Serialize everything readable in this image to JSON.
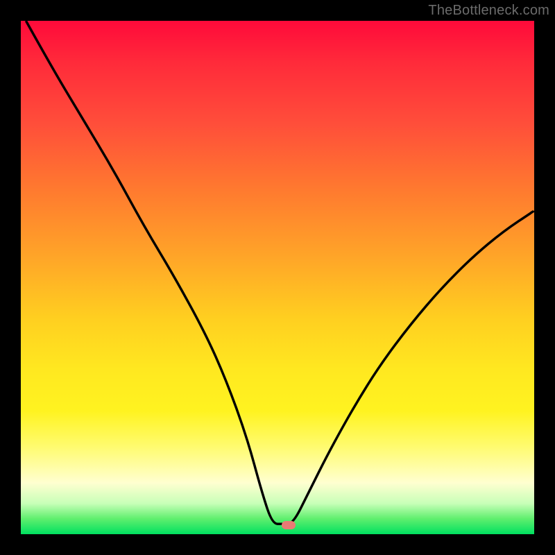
{
  "watermark": "TheBottleneck.com",
  "colors": {
    "gradient_top": "#ff0a3a",
    "gradient_mid1": "#ff7a2f",
    "gradient_mid2": "#ffe820",
    "gradient_bottom": "#00e060",
    "curve": "#000000",
    "marker": "#e97b74",
    "frame": "#000000"
  },
  "marker": {
    "x_frac": 0.522,
    "y_frac": 0.982
  },
  "chart_data": {
    "type": "line",
    "title": "",
    "xlabel": "",
    "ylabel": "",
    "xlim": [
      0,
      100
    ],
    "ylim": [
      0,
      100
    ],
    "grid": false,
    "legend": false,
    "note": "Axes are unlabeled in the source image; values are positional fractions (0–100) read from pixel positions. The curve is a V-shaped bottleneck profile: two descending arms meeting a short flat minimum near y≈2 around x≈48–53, with the right arm rising more gently than the left.",
    "series": [
      {
        "name": "bottleneck-curve",
        "x": [
          1,
          6,
          12,
          18,
          24,
          30,
          36,
          40,
          44,
          47,
          49,
          51,
          53,
          56,
          60,
          65,
          70,
          76,
          82,
          88,
          94,
          100
        ],
        "y": [
          100,
          91,
          81,
          71,
          60,
          50,
          39,
          30,
          19,
          8,
          2,
          2,
          2,
          8,
          16,
          25,
          33,
          41,
          48,
          54,
          59,
          63
        ]
      }
    ],
    "annotations": [
      {
        "type": "point-marker",
        "x": 52.2,
        "y": 1.8,
        "label": ""
      }
    ]
  }
}
